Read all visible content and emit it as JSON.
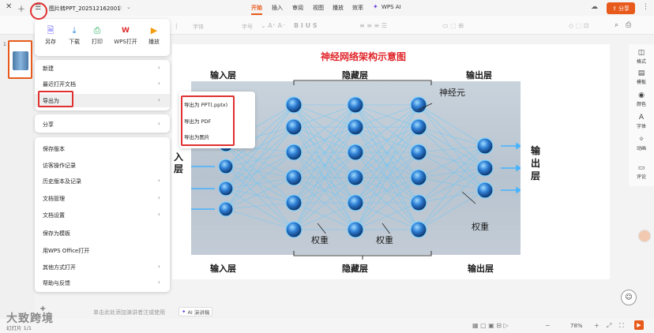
{
  "topbar": {
    "file_name": "图片转PPT_202512162001",
    "tabs": [
      "开始",
      "插入",
      "审阅",
      "视图",
      "播放",
      "效率"
    ],
    "active_tab": "开始",
    "wps_ai": "WPS AI",
    "share": "分享"
  },
  "toolbar": {
    "font_placeholder": "字体",
    "font_size_placeholder": "字号"
  },
  "menu": {
    "quick_actions": [
      {
        "label": "另存",
        "icon": "save-as-icon"
      },
      {
        "label": "下载",
        "icon": "download-icon"
      },
      {
        "label": "打印",
        "icon": "print-icon"
      },
      {
        "label": "WPS打开",
        "icon": "wps-open-icon"
      },
      {
        "label": "播放",
        "icon": "play-icon"
      }
    ],
    "group1": [
      "新建",
      "最近打开文档",
      "导出为"
    ],
    "group2": [
      "分享"
    ],
    "group3": [
      "保存版本",
      "访客操作记录",
      "历史版本及记录",
      "文档管理",
      "文档设置",
      "保存为模板",
      "用WPS Office打开",
      "其他方式打开",
      "帮助与反馈"
    ]
  },
  "submenu": {
    "items": [
      "导出为 PPT(.pptx)",
      "导出为 PDF",
      "导出为图片"
    ]
  },
  "slide": {
    "title": "神经网络架构示意图",
    "label_input_top": "输入层",
    "label_hidden_top": "隐藏层",
    "label_output_top": "输出层",
    "label_neuron": "神经元",
    "label_weight1": "权重",
    "label_weight2": "权重",
    "label_weight3": "权重",
    "label_output_side": "输出层",
    "label_input_side": "入层",
    "label_input_bottom": "输入层",
    "label_hidden_bottom": "隐藏层",
    "label_output_bottom": "输出层"
  },
  "notes": {
    "placeholder": "单击此处添加演讲者注或使用",
    "ai_notes": "AI 演讲稿"
  },
  "status": {
    "slide_counter": "幻灯片 1/1",
    "zoom": "78%",
    "thumb_number": "1",
    "watermark": "大致跨境"
  },
  "rightbar": [
    "格式",
    "模板",
    "颜色",
    "字体",
    "动画",
    "评论"
  ]
}
